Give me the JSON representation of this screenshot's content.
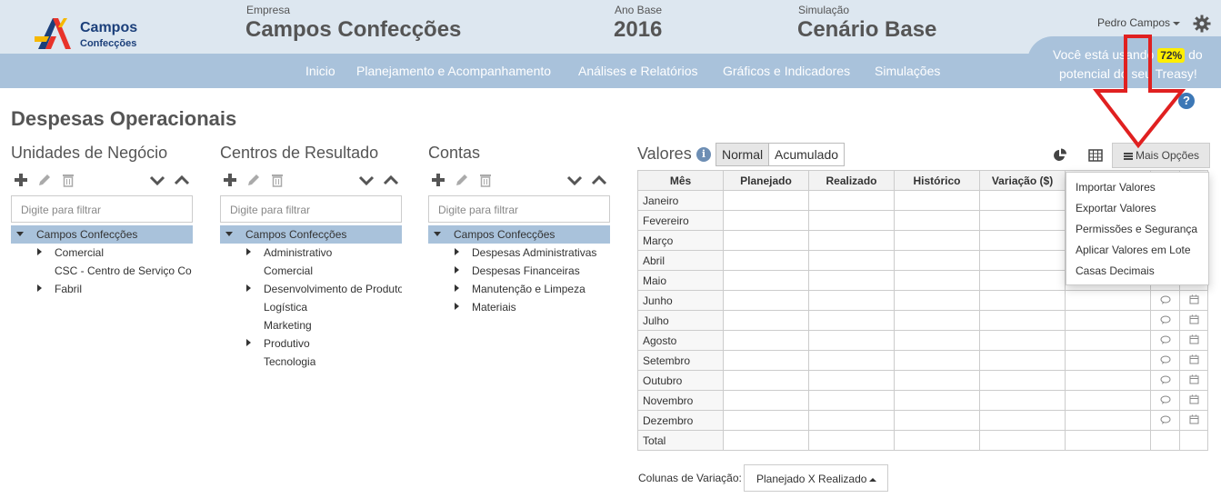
{
  "header": {
    "logo": {
      "line1": "Campos",
      "line2": "Confecções"
    },
    "empresa": {
      "label": "Empresa",
      "value": "Campos Confecções"
    },
    "ano_base": {
      "label": "Ano Base",
      "value": "2016"
    },
    "simulacao": {
      "label": "Simulação",
      "value": "Cenário Base"
    },
    "user": "Pedro Campos",
    "promo": {
      "before": "Você está usando ",
      "percent": "72%",
      "after": " do",
      "line2": "potencial do seu Treasy!"
    }
  },
  "nav": [
    "Inicio",
    "Planejamento e Acompanhamento",
    "Análises e Relatórios",
    "Gráficos e Indicadores",
    "Simulações"
  ],
  "page_title": "Despesas Operacionais",
  "panels": {
    "unidades": {
      "title": "Unidades de Negócio",
      "filter_placeholder": "Digite para filtrar",
      "root": "Campos Confecções",
      "items": [
        "Comercial",
        "CSC - Centro de Serviço Co",
        "Fabril"
      ]
    },
    "centros": {
      "title": "Centros de Resultado",
      "filter_placeholder": "Digite para filtrar",
      "root": "Campos Confecções",
      "items": [
        "Administrativo",
        "Comercial",
        "Desenvolvimento de Produto",
        "Logística",
        "Marketing",
        "Produtivo",
        "Tecnologia"
      ]
    },
    "contas": {
      "title": "Contas",
      "filter_placeholder": "Digite para filtrar",
      "root": "Campos Confecções",
      "items": [
        "Despesas Administrativas",
        "Despesas Financeiras",
        "Manutenção e Limpeza",
        "Materiais"
      ]
    }
  },
  "valores": {
    "title": "Valores",
    "info_glyph": "i",
    "toggle": {
      "normal": "Normal",
      "acumulado": "Acumulado"
    },
    "mais_opcoes": "Mais Opções",
    "columns": [
      "Mês",
      "Planejado",
      "Realizado",
      "Histórico",
      "Variação ($)"
    ],
    "months": [
      "Janeiro",
      "Fevereiro",
      "Março",
      "Abril",
      "Maio",
      "Junho",
      "Julho",
      "Agosto",
      "Setembro",
      "Outubro",
      "Novembro",
      "Dezembro",
      "Total"
    ],
    "dropdown": [
      "Importar Valores",
      "Exportar Valores",
      "Permissões e Segurança",
      "Aplicar Valores em Lote",
      "Casas Decimais"
    ],
    "variacao_label": "Colunas de Variação:",
    "variacao_value": "Planejado X Realizado"
  },
  "help_glyph": "?",
  "colors": {
    "header_bg": "#dde7f0",
    "nav_bg": "#a9c2db",
    "selection": "#a9c2db",
    "arrow": "#e02020",
    "badge": "#ffee00"
  }
}
